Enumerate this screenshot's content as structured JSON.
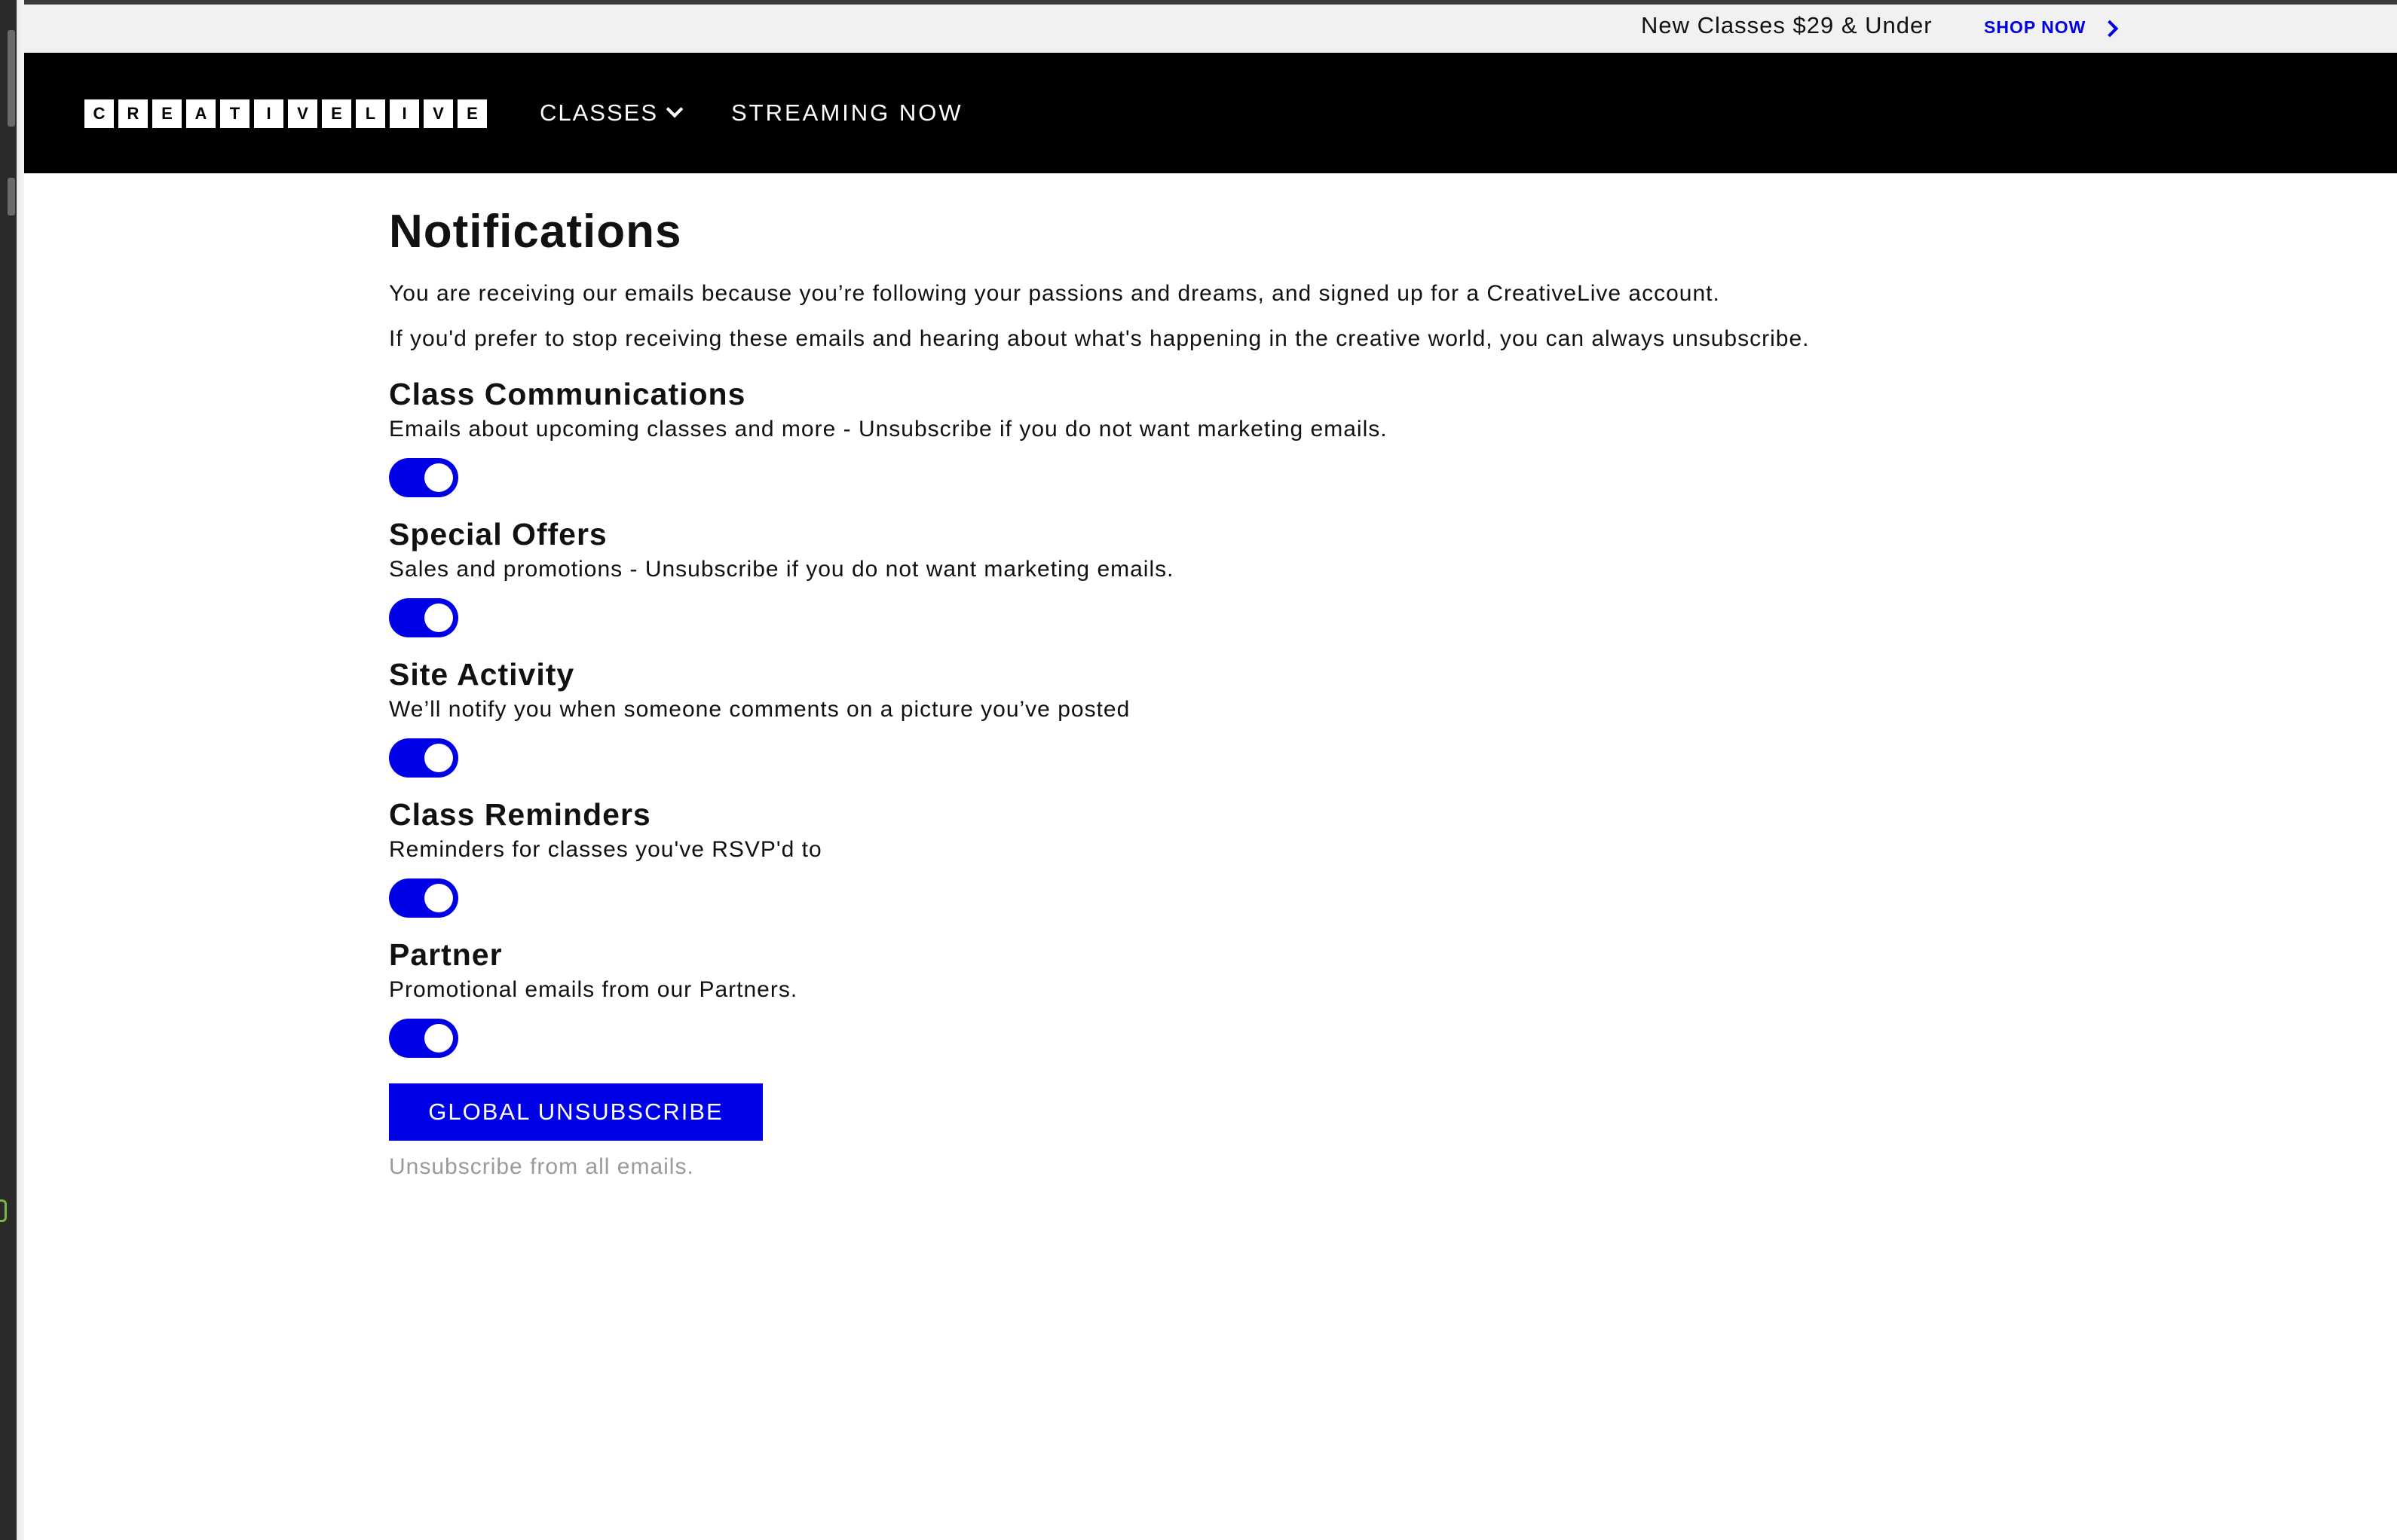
{
  "promo": {
    "text": "New Classes $29 & Under",
    "link_label": "SHOP NOW",
    "accent_color": "#0000e6"
  },
  "nav": {
    "logo_letters": [
      "C",
      "R",
      "E",
      "A",
      "T",
      "I",
      "V",
      "E",
      "L",
      "I",
      "V",
      "E"
    ],
    "classes_label": "CLASSES",
    "streaming_label": "STREAMING NOW"
  },
  "main": {
    "title": "Notifications",
    "intro_1": "You are receiving our emails because you’re following your passions and dreams, and signed up for a CreativeLive account.",
    "intro_2": "If you'd prefer to stop receiving these emails and hearing about what's happening in the creative world, you can always unsubscribe.",
    "sections": [
      {
        "title": "Class Communications",
        "description": "Emails about upcoming classes and more - Unsubscribe if you do not want marketing emails.",
        "enabled": true
      },
      {
        "title": "Special Offers",
        "description": "Sales and promotions - Unsubscribe if you do not want marketing emails.",
        "enabled": true
      },
      {
        "title": "Site Activity",
        "description": "We’ll notify you when someone comments on a picture you’ve posted",
        "enabled": true
      },
      {
        "title": "Class Reminders",
        "description": "Reminders for classes you've RSVP'd to",
        "enabled": true
      },
      {
        "title": "Partner",
        "description": "Promotional emails from our Partners.",
        "enabled": true
      }
    ],
    "global_button_label": "GLOBAL UNSUBSCRIBE",
    "global_note": "Unsubscribe from all emails."
  }
}
